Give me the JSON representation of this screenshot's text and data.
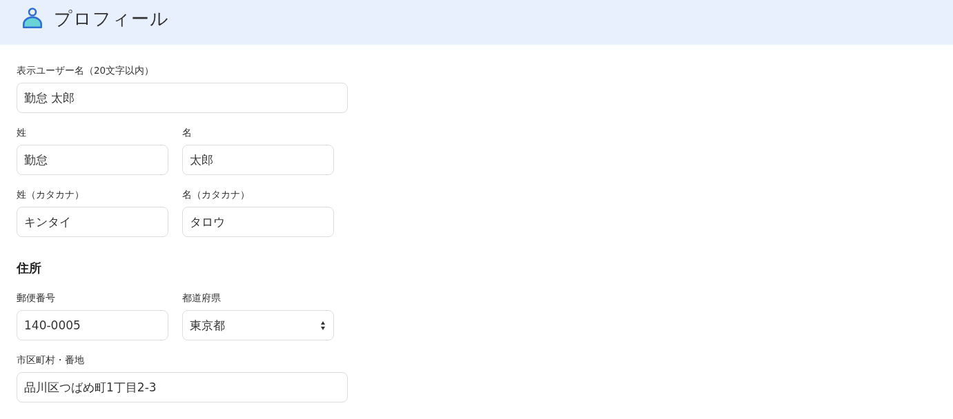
{
  "header": {
    "title": "プロフィール"
  },
  "sections": [
    {
      "rows": [
        [
          {
            "kind": "text",
            "label": "表示ユーザー名（20文字以内）",
            "value": "勤怠 太郎"
          }
        ],
        [
          {
            "kind": "text",
            "label": "姓",
            "value": "勤怠"
          },
          {
            "kind": "text",
            "label": "名",
            "value": "太郎"
          }
        ],
        [
          {
            "kind": "text",
            "label": "姓（カタカナ）",
            "value": "キンタイ"
          },
          {
            "kind": "text",
            "label": "名（カタカナ）",
            "value": "タロウ"
          }
        ]
      ]
    },
    {
      "heading": "住所",
      "rows": [
        [
          {
            "kind": "text",
            "label": "郵便番号",
            "value": "140-0005"
          },
          {
            "kind": "select",
            "label": "都道府県",
            "value": "東京都"
          }
        ],
        [
          {
            "kind": "text",
            "label": "市区町村・番地",
            "value": "品川区つばめ町1丁目2-3"
          }
        ]
      ]
    }
  ]
}
